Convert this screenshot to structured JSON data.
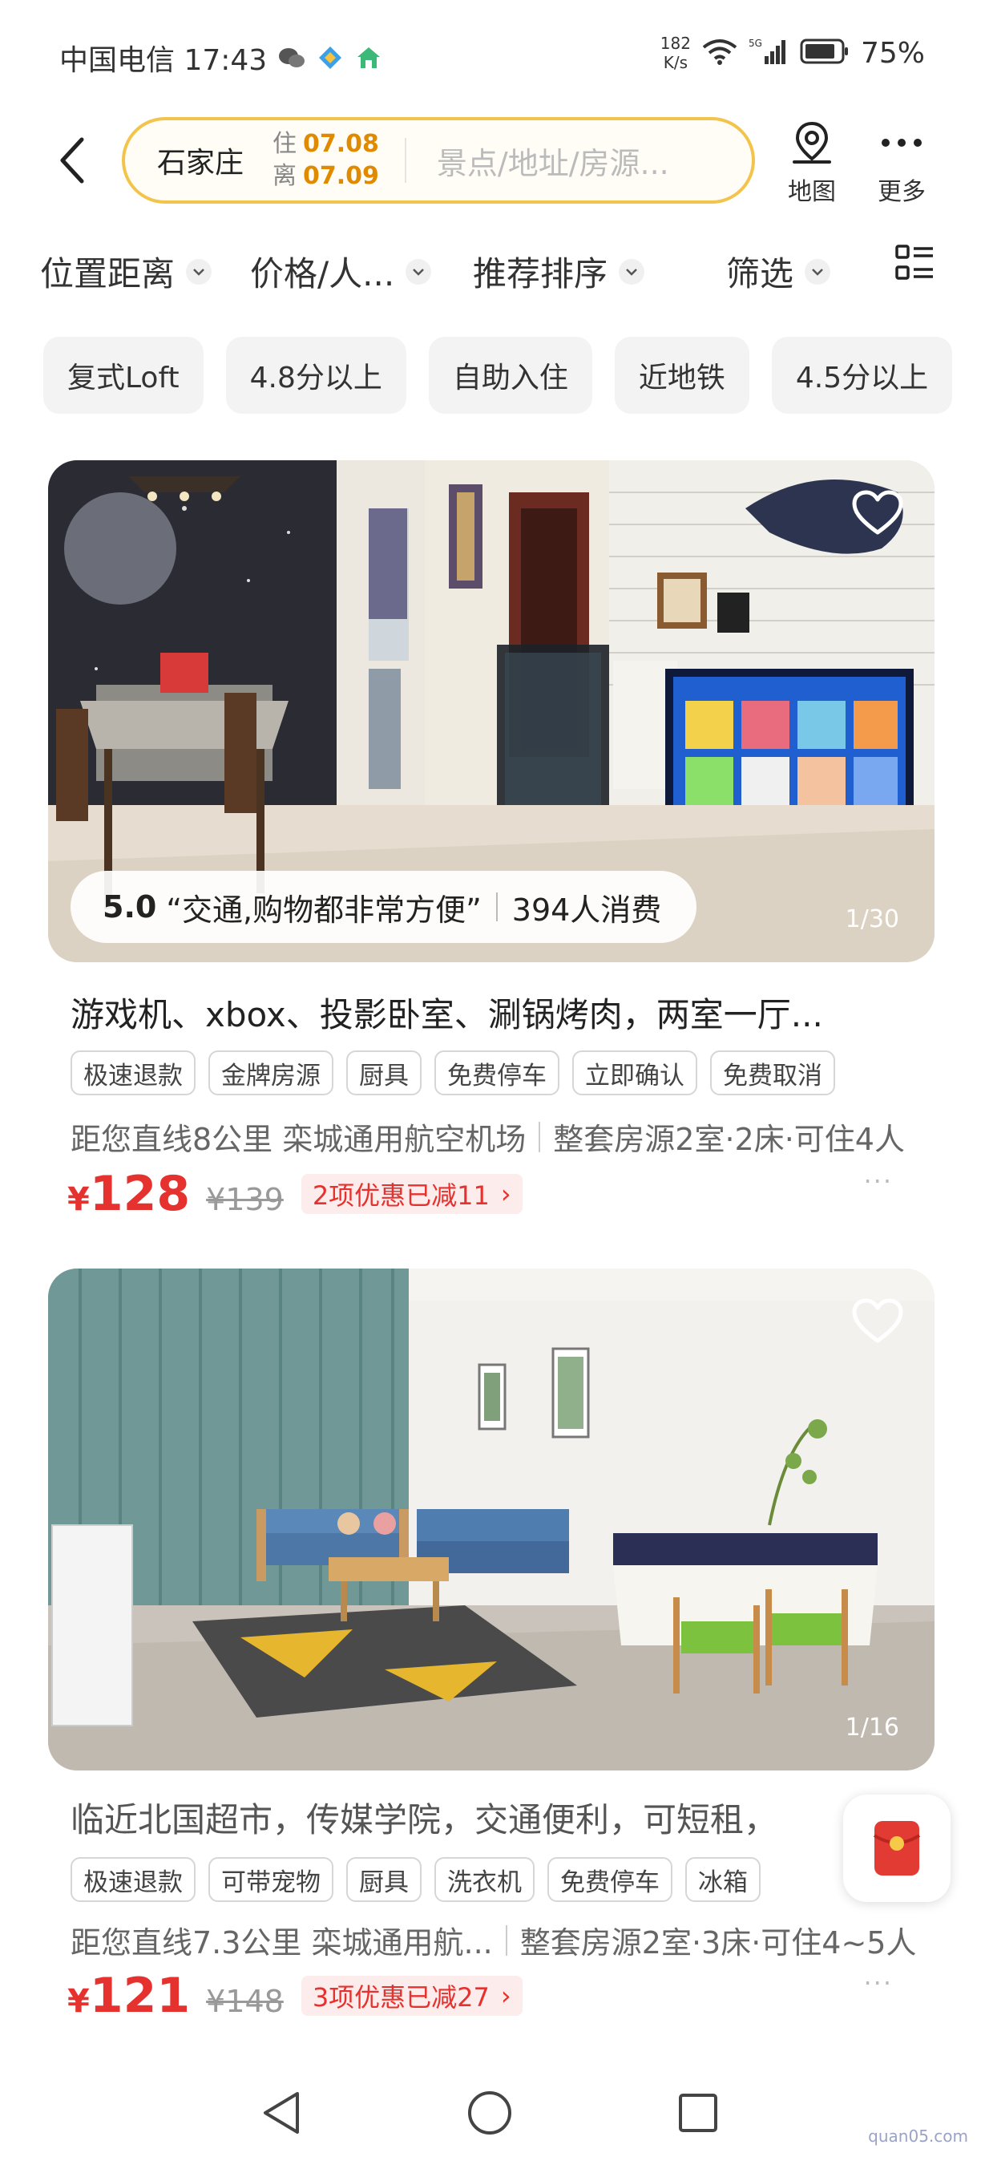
{
  "status_bar": {
    "carrier_time": "中国电信 17:43",
    "net_speed_value": "182",
    "net_speed_unit": "K/s",
    "battery": "75%"
  },
  "header": {
    "back_icon": "chevron-left-icon",
    "city": "石家庄",
    "checkin_label": "住",
    "checkin_date": "07.08",
    "checkout_label": "离",
    "checkout_date": "07.09",
    "search_placeholder": "景点/地址/房源...",
    "map_label": "地图",
    "more_label": "更多",
    "accent_color": "#f3c44c"
  },
  "filters": [
    {
      "label": "位置距离"
    },
    {
      "label": "价格/人..."
    },
    {
      "label": "推荐排序"
    },
    {
      "label": "筛选"
    }
  ],
  "quick_tags": [
    "复式Loft",
    "4.8分以上",
    "自助入住",
    "近地铁",
    "4.5分以上"
  ],
  "listings": [
    {
      "photo_counter": "1/30",
      "review_score": "5.0",
      "review_quote": "“交通,购物都非常方便”",
      "review_count": "394人消费",
      "title": "游戏机、xbox、投影卧室、涮锅烤肉，两室一厅...",
      "badges": [
        "极速退款",
        "金牌房源",
        "厨具",
        "免费停车",
        "立即确认",
        "免费取消"
      ],
      "distance": "距您直线8公里 栾城通用航空机场",
      "room_info": "整套房源2室·2床·可住4人",
      "price_symbol": "¥",
      "price": "128",
      "original_price": "¥139",
      "promo": "2项优惠已减11",
      "promo_arrow": "›",
      "more": "···"
    },
    {
      "photo_counter": "1/16",
      "title": "临近北国超市，传媒学院，交通便利，可短租，",
      "badges": [
        "极速退款",
        "可带宠物",
        "厨具",
        "洗衣机",
        "免费停车",
        "冰箱"
      ],
      "distance": "距您直线7.3公里 栾城通用航...",
      "room_info": "整套房源2室·3床·可住4~5人",
      "price_symbol": "¥",
      "price": "121",
      "original_price": "¥148",
      "promo": "3项优惠已减27",
      "promo_arrow": "›",
      "more": "···"
    }
  ],
  "watermark": "quan05.com",
  "price_color": "#e6322e"
}
